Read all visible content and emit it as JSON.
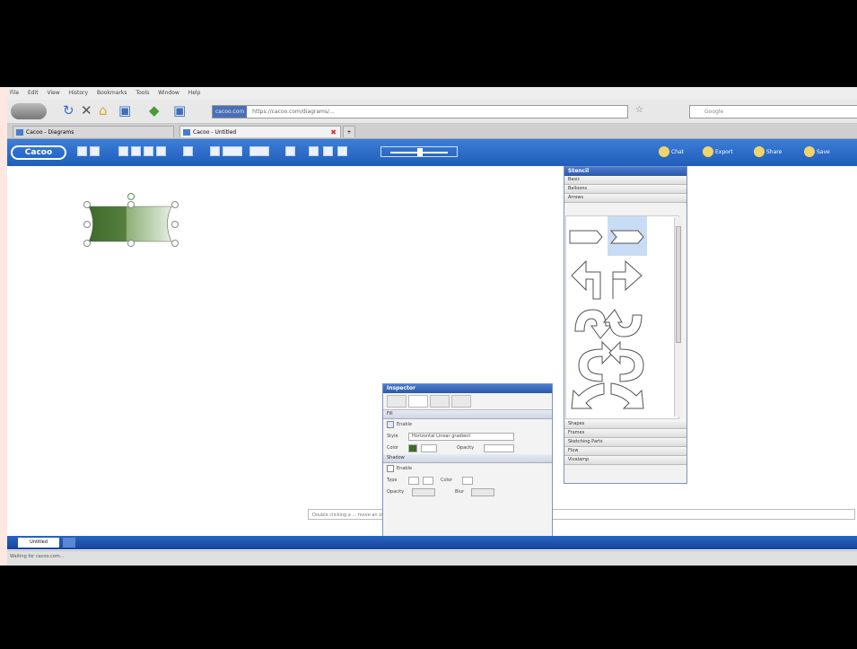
{
  "menu": [
    "File",
    "Edit",
    "View",
    "History",
    "Bookmarks",
    "Tools",
    "Window",
    "Help"
  ],
  "nav": {
    "url_badge": "cacoo.com",
    "url_text": "https://cacoo.com/diagrams/…",
    "search_placeholder": "Google"
  },
  "tabs": [
    {
      "label": "Cacoo - Diagrams"
    },
    {
      "label": "Cacoo - Untitled"
    }
  ],
  "toolbar": {
    "logo": "Cacoo",
    "right_buttons": [
      "Chat",
      "Export",
      "Share",
      "Save"
    ]
  },
  "palette": {
    "title": "Stencil",
    "categories_top": [
      "Basic",
      "Balloons",
      "Arrows"
    ],
    "categories_bottom": [
      "Shapes",
      "Frames",
      "Sketching Parts",
      "Flow",
      "Vivalamp"
    ]
  },
  "inspector": {
    "title": "Inspector",
    "section_fill": "Fill",
    "fill_label": "Enable",
    "type_label": "Style",
    "type_value": "Horizontal Linear gradient",
    "color_label": "Color",
    "opacity_label": "Opacity",
    "section_shadow": "Shadow",
    "shadow_label": "Enable",
    "shadow_type": "Type",
    "shadow_color": "Color",
    "shadow_opacity": "Opacity",
    "shadow_blur": "Blur"
  },
  "hint": "Double clicking a ... move an object, Ctrl/Alt+Drag connects the copied object to the original.",
  "bottom_tab": "Untitled",
  "status": "Waiting for cacoo.com...",
  "colors": {
    "toolbar": "#2a66c4",
    "shape_dark": "#3f6b2a",
    "shape_light": "#b9d1a8"
  }
}
